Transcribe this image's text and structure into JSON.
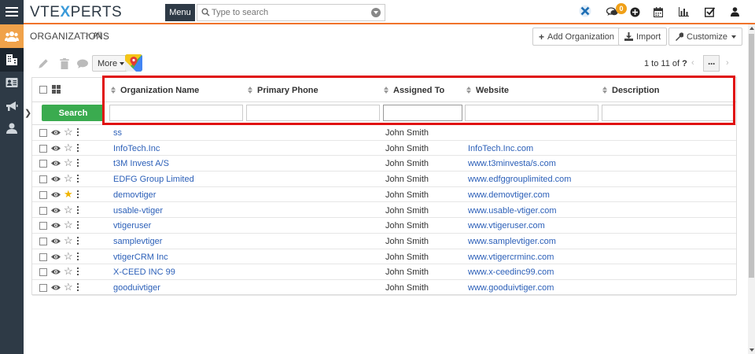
{
  "brand": {
    "logo_left": "VTE",
    "logo_x": "X",
    "logo_right": "PERTS"
  },
  "header": {
    "menu_label": "Menu",
    "search_placeholder": "Type to search",
    "notification_count": "0"
  },
  "breadcrumb": {
    "module": "ORGANIZATIONS",
    "separator": ">",
    "view": "All"
  },
  "actions": {
    "add": "Add Organization",
    "import": "Import",
    "customize": "Customize"
  },
  "toolbar": {
    "more_label": "More",
    "pager_range": "1 to 11",
    "pager_of": "of",
    "pager_total": "?"
  },
  "table": {
    "columns": [
      "Organization Name",
      "Primary Phone",
      "Assigned To",
      "Website",
      "Description"
    ],
    "search_label": "Search",
    "rows": [
      {
        "name": "ss",
        "assigned": "John Smith",
        "website": "",
        "starred": false
      },
      {
        "name": "InfoTech.Inc",
        "assigned": "John Smith",
        "website": "InfoTech.Inc.com",
        "starred": false
      },
      {
        "name": "t3M Invest A/S",
        "assigned": "John Smith",
        "website": "www.t3minvesta/s.com",
        "starred": false
      },
      {
        "name": "EDFG Group Limited",
        "assigned": "John Smith",
        "website": "www.edfggrouplimited.com",
        "starred": false
      },
      {
        "name": "demovtiger",
        "assigned": "John Smith",
        "website": "www.demovtiger.com",
        "starred": true
      },
      {
        "name": "usable-vtiger",
        "assigned": "John Smith",
        "website": "www.usable-vtiger.com",
        "starred": false
      },
      {
        "name": "vtigeruser",
        "assigned": "John Smith",
        "website": "www.vtigeruser.com",
        "starred": false
      },
      {
        "name": "samplevtiger",
        "assigned": "John Smith",
        "website": "www.samplevtiger.com",
        "starred": false
      },
      {
        "name": "vtigerCRM Inc",
        "assigned": "John Smith",
        "website": "www.vtigercrminc.com",
        "starred": false
      },
      {
        "name": "X-CEED INC 99",
        "assigned": "John Smith",
        "website": "www.x-ceedinc99.com",
        "starred": false
      },
      {
        "name": "gooduivtiger",
        "assigned": "John Smith",
        "website": "www.gooduivtiger.com",
        "starred": false
      }
    ]
  },
  "colors": {
    "accent": "#f0732b",
    "rail": "#2e3a46",
    "search_button": "#3aab4f",
    "link": "#2b5fb8",
    "highlight": "#e01010",
    "star": "#f0b400"
  }
}
